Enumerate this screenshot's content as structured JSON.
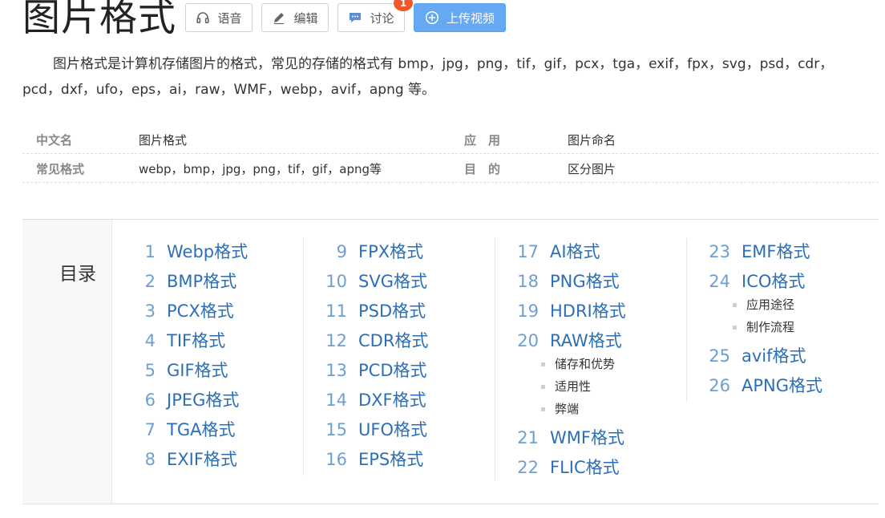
{
  "page": {
    "title": "图片格式",
    "summary": "图片格式是计算机存储图片的格式，常见的存储的格式有 bmp，jpg，png，tif，gif，pcx，tga，exif，fpx，svg，psd，cdr，pcd，dxf，ufo，eps，ai，raw，WMF，webp，avif，apng 等。"
  },
  "toolbar": {
    "voice_label": "语音",
    "edit_label": "编辑",
    "discuss_label": "讨论",
    "discuss_badge": "1",
    "upload_label": "上传视频"
  },
  "basic_info": {
    "rows": [
      {
        "k1": "中文名",
        "v1": "图片格式",
        "k2": "应用",
        "v2": "图片命名"
      },
      {
        "k1": "常见格式",
        "v1": "webp，bmp，jpg，png，tif，gif，apng等",
        "k2": "目的",
        "v2": "区分图片"
      }
    ]
  },
  "toc": {
    "label": "目录",
    "items": [
      {
        "num": "1",
        "label": "Webp格式"
      },
      {
        "num": "2",
        "label": "BMP格式"
      },
      {
        "num": "3",
        "label": "PCX格式"
      },
      {
        "num": "4",
        "label": "TIF格式"
      },
      {
        "num": "5",
        "label": "GIF格式"
      },
      {
        "num": "6",
        "label": "JPEG格式"
      },
      {
        "num": "7",
        "label": "TGA格式"
      },
      {
        "num": "8",
        "label": "EXIF格式"
      },
      {
        "num": "9",
        "label": "FPX格式"
      },
      {
        "num": "10",
        "label": "SVG格式"
      },
      {
        "num": "11",
        "label": "PSD格式"
      },
      {
        "num": "12",
        "label": "CDR格式"
      },
      {
        "num": "13",
        "label": "PCD格式"
      },
      {
        "num": "14",
        "label": "DXF格式"
      },
      {
        "num": "15",
        "label": "UFO格式"
      },
      {
        "num": "16",
        "label": "EPS格式"
      },
      {
        "num": "17",
        "label": "AI格式"
      },
      {
        "num": "18",
        "label": "PNG格式"
      },
      {
        "num": "19",
        "label": "HDRI格式"
      },
      {
        "num": "20",
        "label": "RAW格式"
      },
      {
        "num": "21",
        "label": "WMF格式"
      },
      {
        "num": "22",
        "label": "FLIC格式"
      },
      {
        "num": "23",
        "label": "EMF格式"
      },
      {
        "num": "24",
        "label": "ICO格式"
      },
      {
        "num": "25",
        "label": "avif格式"
      },
      {
        "num": "26",
        "label": "APNG格式"
      }
    ],
    "raw_subitems": [
      "储存和优势",
      "适用性",
      "弊端"
    ],
    "ico_subitems": [
      "应用途径",
      "制作流程"
    ]
  },
  "colors": {
    "link": "#2d6fb7",
    "link_number": "#6d9fd0",
    "upload_button": "#64a9f2",
    "badge": "#f0582c"
  },
  "icons": [
    "headphones-icon",
    "pencil-icon",
    "chat-icon",
    "plus-circle-icon"
  ]
}
